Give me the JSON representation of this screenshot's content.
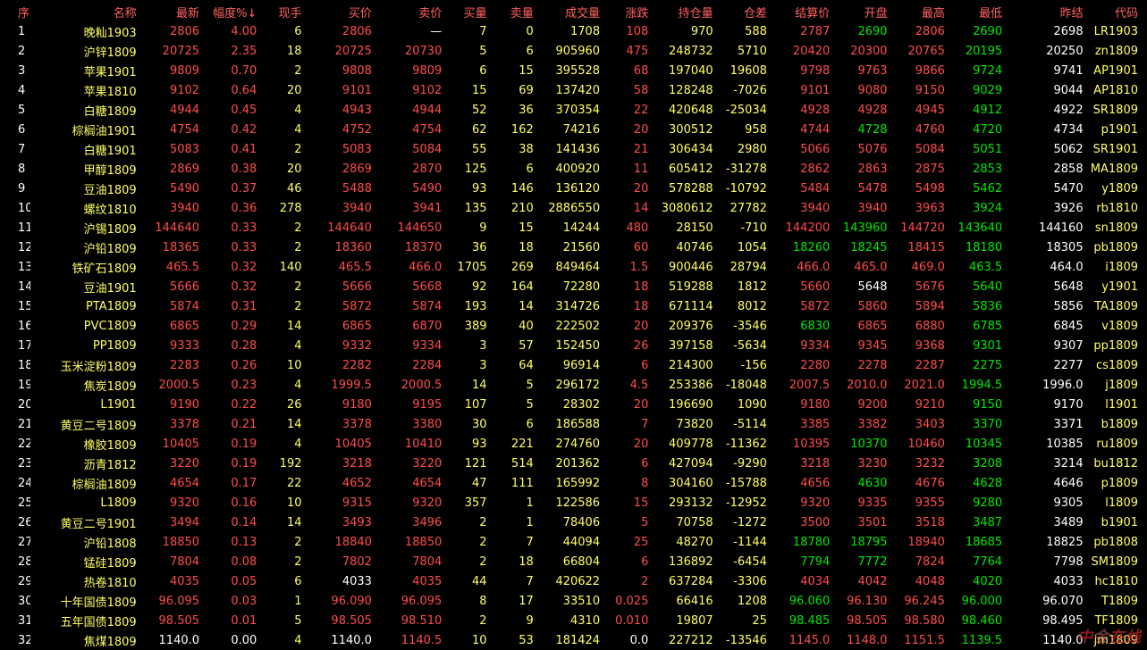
{
  "headers": {
    "seq": "序",
    "name": "名称",
    "last": "最新",
    "pct": "幅度%",
    "sort_indicator": "↓",
    "vol_now": "现手",
    "bid": "买价",
    "ask": "卖价",
    "bid_vol": "买量",
    "ask_vol": "卖量",
    "volume": "成交量",
    "change": "涨跌",
    "oi": "持仓量",
    "oi_diff": "仓差",
    "settle": "结算价",
    "open": "开盘",
    "high": "最高",
    "low": "最低",
    "prev_settle": "昨结",
    "code": "代码"
  },
  "colors": {
    "up": "#ff4c4c",
    "down": "#00e800",
    "flat": "#ffffff",
    "name": "#ffff66",
    "header": "#ff6060"
  },
  "rows": [
    {
      "seq": "1",
      "name": "晚籼1903",
      "last": "2806",
      "pct": "4.00",
      "vol_now": "6",
      "bid": "2806",
      "ask": "—",
      "bid_vol": "7",
      "ask_vol": "0",
      "volume": "1708",
      "change": "108",
      "oi": "970",
      "oi_diff": "588",
      "settle": "2787",
      "open": "2690",
      "high": "2806",
      "low": "2690",
      "prev_settle": "2698",
      "code": "LR1903"
    },
    {
      "seq": "2",
      "name": "沪锌1809",
      "last": "20725",
      "pct": "2.35",
      "vol_now": "18",
      "bid": "20725",
      "ask": "20730",
      "bid_vol": "5",
      "ask_vol": "6",
      "volume": "905960",
      "change": "475",
      "oi": "248732",
      "oi_diff": "5710",
      "settle": "20420",
      "open": "20300",
      "high": "20765",
      "low": "20195",
      "prev_settle": "20250",
      "code": "zn1809"
    },
    {
      "seq": "3",
      "name": "苹果1901",
      "last": "9809",
      "pct": "0.70",
      "vol_now": "2",
      "bid": "9808",
      "ask": "9809",
      "bid_vol": "6",
      "ask_vol": "15",
      "volume": "395528",
      "change": "68",
      "oi": "197040",
      "oi_diff": "19608",
      "settle": "9798",
      "open": "9763",
      "high": "9866",
      "low": "9724",
      "prev_settle": "9741",
      "code": "AP1901"
    },
    {
      "seq": "4",
      "name": "苹果1810",
      "last": "9102",
      "pct": "0.64",
      "vol_now": "20",
      "bid": "9101",
      "ask": "9102",
      "bid_vol": "15",
      "ask_vol": "69",
      "volume": "137420",
      "change": "58",
      "oi": "128248",
      "oi_diff": "-7026",
      "settle": "9101",
      "open": "9080",
      "high": "9150",
      "low": "9029",
      "prev_settle": "9044",
      "code": "AP1810"
    },
    {
      "seq": "5",
      "name": "白糖1809",
      "last": "4944",
      "pct": "0.45",
      "vol_now": "4",
      "bid": "4943",
      "ask": "4944",
      "bid_vol": "52",
      "ask_vol": "36",
      "volume": "370354",
      "change": "22",
      "oi": "420648",
      "oi_diff": "-25034",
      "settle": "4928",
      "open": "4928",
      "high": "4945",
      "low": "4912",
      "prev_settle": "4922",
      "code": "SR1809"
    },
    {
      "seq": "6",
      "name": "棕榈油1901",
      "last": "4754",
      "pct": "0.42",
      "vol_now": "4",
      "bid": "4752",
      "ask": "4754",
      "bid_vol": "62",
      "ask_vol": "162",
      "volume": "74216",
      "change": "20",
      "oi": "300512",
      "oi_diff": "958",
      "settle": "4744",
      "open": "4728",
      "high": "4760",
      "low": "4720",
      "prev_settle": "4734",
      "code": "p1901"
    },
    {
      "seq": "7",
      "name": "白糖1901",
      "last": "5083",
      "pct": "0.41",
      "vol_now": "2",
      "bid": "5083",
      "ask": "5084",
      "bid_vol": "55",
      "ask_vol": "38",
      "volume": "141436",
      "change": "21",
      "oi": "306434",
      "oi_diff": "2980",
      "settle": "5066",
      "open": "5076",
      "high": "5084",
      "low": "5051",
      "prev_settle": "5062",
      "code": "SR1901"
    },
    {
      "seq": "8",
      "name": "甲醇1809",
      "last": "2869",
      "pct": "0.38",
      "vol_now": "20",
      "bid": "2869",
      "ask": "2870",
      "bid_vol": "125",
      "ask_vol": "6",
      "volume": "400920",
      "change": "11",
      "oi": "605412",
      "oi_diff": "-31278",
      "settle": "2862",
      "open": "2863",
      "high": "2875",
      "low": "2853",
      "prev_settle": "2858",
      "code": "MA1809"
    },
    {
      "seq": "9",
      "name": "豆油1809",
      "last": "5490",
      "pct": "0.37",
      "vol_now": "46",
      "bid": "5488",
      "ask": "5490",
      "bid_vol": "93",
      "ask_vol": "146",
      "volume": "136120",
      "change": "20",
      "oi": "578288",
      "oi_diff": "-10792",
      "settle": "5484",
      "open": "5478",
      "high": "5498",
      "low": "5462",
      "prev_settle": "5470",
      "code": "y1809"
    },
    {
      "seq": "10",
      "name": "螺纹1810",
      "last": "3940",
      "pct": "0.36",
      "vol_now": "278",
      "bid": "3940",
      "ask": "3941",
      "bid_vol": "135",
      "ask_vol": "210",
      "volume": "2886550",
      "change": "14",
      "oi": "3080612",
      "oi_diff": "27782",
      "settle": "3940",
      "open": "3940",
      "high": "3963",
      "low": "3924",
      "prev_settle": "3926",
      "code": "rb1810"
    },
    {
      "seq": "11",
      "name": "沪锡1809",
      "last": "144640",
      "pct": "0.33",
      "vol_now": "2",
      "bid": "144640",
      "ask": "144650",
      "bid_vol": "9",
      "ask_vol": "15",
      "volume": "14244",
      "change": "480",
      "oi": "28150",
      "oi_diff": "-710",
      "settle": "144200",
      "open": "143960",
      "high": "144720",
      "low": "143640",
      "prev_settle": "144160",
      "code": "sn1809"
    },
    {
      "seq": "12",
      "name": "沪铅1809",
      "last": "18365",
      "pct": "0.33",
      "vol_now": "2",
      "bid": "18360",
      "ask": "18370",
      "bid_vol": "36",
      "ask_vol": "18",
      "volume": "21560",
      "change": "60",
      "oi": "40746",
      "oi_diff": "1054",
      "settle": "18260",
      "open": "18245",
      "high": "18415",
      "low": "18180",
      "prev_settle": "18305",
      "code": "pb1809"
    },
    {
      "seq": "13",
      "name": "铁矿石1809",
      "last": "465.5",
      "pct": "0.32",
      "vol_now": "140",
      "bid": "465.5",
      "ask": "466.0",
      "bid_vol": "1705",
      "ask_vol": "269",
      "volume": "849464",
      "change": "1.5",
      "oi": "900446",
      "oi_diff": "28794",
      "settle": "466.0",
      "open": "465.0",
      "high": "469.0",
      "low": "463.5",
      "prev_settle": "464.0",
      "code": "i1809"
    },
    {
      "seq": "14",
      "name": "豆油1901",
      "last": "5666",
      "pct": "0.32",
      "vol_now": "2",
      "bid": "5666",
      "ask": "5668",
      "bid_vol": "92",
      "ask_vol": "164",
      "volume": "72280",
      "change": "18",
      "oi": "519288",
      "oi_diff": "1812",
      "settle": "5660",
      "open": "5648",
      "high": "5676",
      "low": "5640",
      "prev_settle": "5648",
      "code": "y1901"
    },
    {
      "seq": "15",
      "name": "PTA1809",
      "last": "5874",
      "pct": "0.31",
      "vol_now": "2",
      "bid": "5872",
      "ask": "5874",
      "bid_vol": "193",
      "ask_vol": "14",
      "volume": "314726",
      "change": "18",
      "oi": "671114",
      "oi_diff": "8012",
      "settle": "5872",
      "open": "5860",
      "high": "5894",
      "low": "5836",
      "prev_settle": "5856",
      "code": "TA1809"
    },
    {
      "seq": "16",
      "name": "PVC1809",
      "last": "6865",
      "pct": "0.29",
      "vol_now": "14",
      "bid": "6865",
      "ask": "6870",
      "bid_vol": "389",
      "ask_vol": "40",
      "volume": "222502",
      "change": "20",
      "oi": "209376",
      "oi_diff": "-3546",
      "settle": "6830",
      "open": "6865",
      "high": "6880",
      "low": "6785",
      "prev_settle": "6845",
      "code": "v1809"
    },
    {
      "seq": "17",
      "name": "PP1809",
      "last": "9333",
      "pct": "0.28",
      "vol_now": "4",
      "bid": "9332",
      "ask": "9334",
      "bid_vol": "3",
      "ask_vol": "57",
      "volume": "152450",
      "change": "26",
      "oi": "397158",
      "oi_diff": "-5634",
      "settle": "9334",
      "open": "9345",
      "high": "9368",
      "low": "9301",
      "prev_settle": "9307",
      "code": "pp1809"
    },
    {
      "seq": "18",
      "name": "玉米淀粉1809",
      "last": "2283",
      "pct": "0.26",
      "vol_now": "10",
      "bid": "2282",
      "ask": "2284",
      "bid_vol": "3",
      "ask_vol": "64",
      "volume": "96914",
      "change": "6",
      "oi": "214300",
      "oi_diff": "-156",
      "settle": "2280",
      "open": "2278",
      "high": "2287",
      "low": "2275",
      "prev_settle": "2277",
      "code": "cs1809"
    },
    {
      "seq": "19",
      "name": "焦炭1809",
      "last": "2000.5",
      "pct": "0.23",
      "vol_now": "4",
      "bid": "1999.5",
      "ask": "2000.5",
      "bid_vol": "14",
      "ask_vol": "5",
      "volume": "296172",
      "change": "4.5",
      "oi": "253386",
      "oi_diff": "-18048",
      "settle": "2007.5",
      "open": "2010.0",
      "high": "2021.0",
      "low": "1994.5",
      "prev_settle": "1996.0",
      "code": "j1809"
    },
    {
      "seq": "20",
      "name": "L1901",
      "last": "9190",
      "pct": "0.22",
      "vol_now": "26",
      "bid": "9180",
      "ask": "9195",
      "bid_vol": "107",
      "ask_vol": "5",
      "volume": "28302",
      "change": "20",
      "oi": "196690",
      "oi_diff": "1090",
      "settle": "9180",
      "open": "9200",
      "high": "9210",
      "low": "9150",
      "prev_settle": "9170",
      "code": "l1901"
    },
    {
      "seq": "21",
      "name": "黄豆二号1809",
      "last": "3378",
      "pct": "0.21",
      "vol_now": "14",
      "bid": "3378",
      "ask": "3380",
      "bid_vol": "30",
      "ask_vol": "6",
      "volume": "186588",
      "change": "7",
      "oi": "73820",
      "oi_diff": "-5114",
      "settle": "3385",
      "open": "3382",
      "high": "3403",
      "low": "3370",
      "prev_settle": "3371",
      "code": "b1809"
    },
    {
      "seq": "22",
      "name": "橡胶1809",
      "last": "10405",
      "pct": "0.19",
      "vol_now": "4",
      "bid": "10405",
      "ask": "10410",
      "bid_vol": "93",
      "ask_vol": "221",
      "volume": "274760",
      "change": "20",
      "oi": "409778",
      "oi_diff": "-11362",
      "settle": "10395",
      "open": "10370",
      "high": "10460",
      "low": "10345",
      "prev_settle": "10385",
      "code": "ru1809"
    },
    {
      "seq": "23",
      "name": "沥青1812",
      "last": "3220",
      "pct": "0.19",
      "vol_now": "192",
      "bid": "3218",
      "ask": "3220",
      "bid_vol": "121",
      "ask_vol": "514",
      "volume": "201362",
      "change": "6",
      "oi": "427094",
      "oi_diff": "-9290",
      "settle": "3218",
      "open": "3230",
      "high": "3232",
      "low": "3208",
      "prev_settle": "3214",
      "code": "bu1812"
    },
    {
      "seq": "24",
      "name": "棕榈油1809",
      "last": "4654",
      "pct": "0.17",
      "vol_now": "22",
      "bid": "4652",
      "ask": "4654",
      "bid_vol": "47",
      "ask_vol": "111",
      "volume": "165992",
      "change": "8",
      "oi": "304160",
      "oi_diff": "-15788",
      "settle": "4656",
      "open": "4630",
      "high": "4676",
      "low": "4628",
      "prev_settle": "4646",
      "code": "p1809"
    },
    {
      "seq": "25",
      "name": "L1809",
      "last": "9320",
      "pct": "0.16",
      "vol_now": "10",
      "bid": "9315",
      "ask": "9320",
      "bid_vol": "357",
      "ask_vol": "1",
      "volume": "122586",
      "change": "15",
      "oi": "293132",
      "oi_diff": "-12952",
      "settle": "9320",
      "open": "9335",
      "high": "9355",
      "low": "9280",
      "prev_settle": "9305",
      "code": "l1809"
    },
    {
      "seq": "26",
      "name": "黄豆二号1901",
      "last": "3494",
      "pct": "0.14",
      "vol_now": "14",
      "bid": "3493",
      "ask": "3496",
      "bid_vol": "2",
      "ask_vol": "1",
      "volume": "78406",
      "change": "5",
      "oi": "70758",
      "oi_diff": "-1272",
      "settle": "3500",
      "open": "3501",
      "high": "3518",
      "low": "3487",
      "prev_settle": "3489",
      "code": "b1901"
    },
    {
      "seq": "27",
      "name": "沪铅1808",
      "last": "18850",
      "pct": "0.13",
      "vol_now": "2",
      "bid": "18840",
      "ask": "18850",
      "bid_vol": "2",
      "ask_vol": "7",
      "volume": "44094",
      "change": "25",
      "oi": "48270",
      "oi_diff": "-1144",
      "settle": "18780",
      "open": "18795",
      "high": "18940",
      "low": "18685",
      "prev_settle": "18825",
      "code": "pb1808"
    },
    {
      "seq": "28",
      "name": "锰硅1809",
      "last": "7804",
      "pct": "0.08",
      "vol_now": "2",
      "bid": "7802",
      "ask": "7804",
      "bid_vol": "2",
      "ask_vol": "18",
      "volume": "66804",
      "change": "6",
      "oi": "136892",
      "oi_diff": "-6454",
      "settle": "7794",
      "open": "7772",
      "high": "7824",
      "low": "7764",
      "prev_settle": "7798",
      "code": "SM1809"
    },
    {
      "seq": "29",
      "name": "热卷1810",
      "last": "4035",
      "pct": "0.05",
      "vol_now": "6",
      "bid": "4033",
      "ask": "4035",
      "bid_vol": "44",
      "ask_vol": "7",
      "volume": "420622",
      "change": "2",
      "oi": "637284",
      "oi_diff": "-3306",
      "settle": "4034",
      "open": "4042",
      "high": "4048",
      "low": "4020",
      "prev_settle": "4033",
      "code": "hc1810"
    },
    {
      "seq": "30",
      "name": "十年国债1809",
      "last": "96.095",
      "pct": "0.03",
      "vol_now": "1",
      "bid": "96.090",
      "ask": "96.095",
      "bid_vol": "8",
      "ask_vol": "17",
      "volume": "33510",
      "change": "0.025",
      "oi": "66416",
      "oi_diff": "1208",
      "settle": "96.060",
      "open": "96.130",
      "high": "96.245",
      "low": "96.000",
      "prev_settle": "96.070",
      "code": "T1809"
    },
    {
      "seq": "31",
      "name": "五年国债1809",
      "last": "98.505",
      "pct": "0.01",
      "vol_now": "5",
      "bid": "98.505",
      "ask": "98.510",
      "bid_vol": "2",
      "ask_vol": "9",
      "volume": "4310",
      "change": "0.010",
      "oi": "19807",
      "oi_diff": "25",
      "settle": "98.485",
      "open": "98.505",
      "high": "98.580",
      "low": "98.460",
      "prev_settle": "98.495",
      "code": "TF1809"
    },
    {
      "seq": "32",
      "name": "焦煤1809",
      "last": "1140.0",
      "pct": "0.00",
      "vol_now": "4",
      "bid": "1140.0",
      "ask": "1140.5",
      "bid_vol": "10",
      "ask_vol": "53",
      "volume": "181424",
      "change": "0.0",
      "oi": "227212",
      "oi_diff": "-13546",
      "settle": "1145.0",
      "open": "1148.0",
      "high": "1151.5",
      "low": "1139.5",
      "prev_settle": "1140.0",
      "code": "jm1809"
    }
  ]
}
